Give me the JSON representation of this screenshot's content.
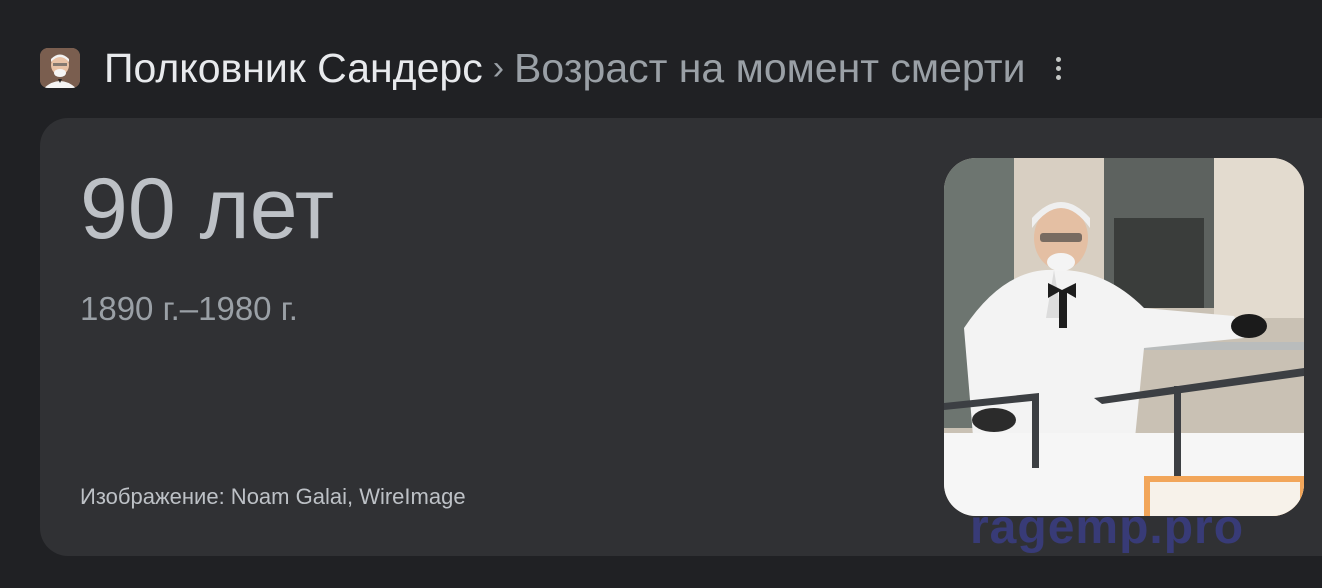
{
  "header": {
    "title": "Полковник Сандерс",
    "separator": "›",
    "subtitle": "Возраст на момент смерти"
  },
  "card": {
    "age": "90 лет",
    "years": "1890 г.–1980 г.",
    "credit": "Изображение: Noam Galai, WireImage"
  },
  "watermark": "ragemp.pro",
  "icons": {
    "avatar": "colonel-sanders-avatar",
    "more": "more-vertical-icon"
  }
}
